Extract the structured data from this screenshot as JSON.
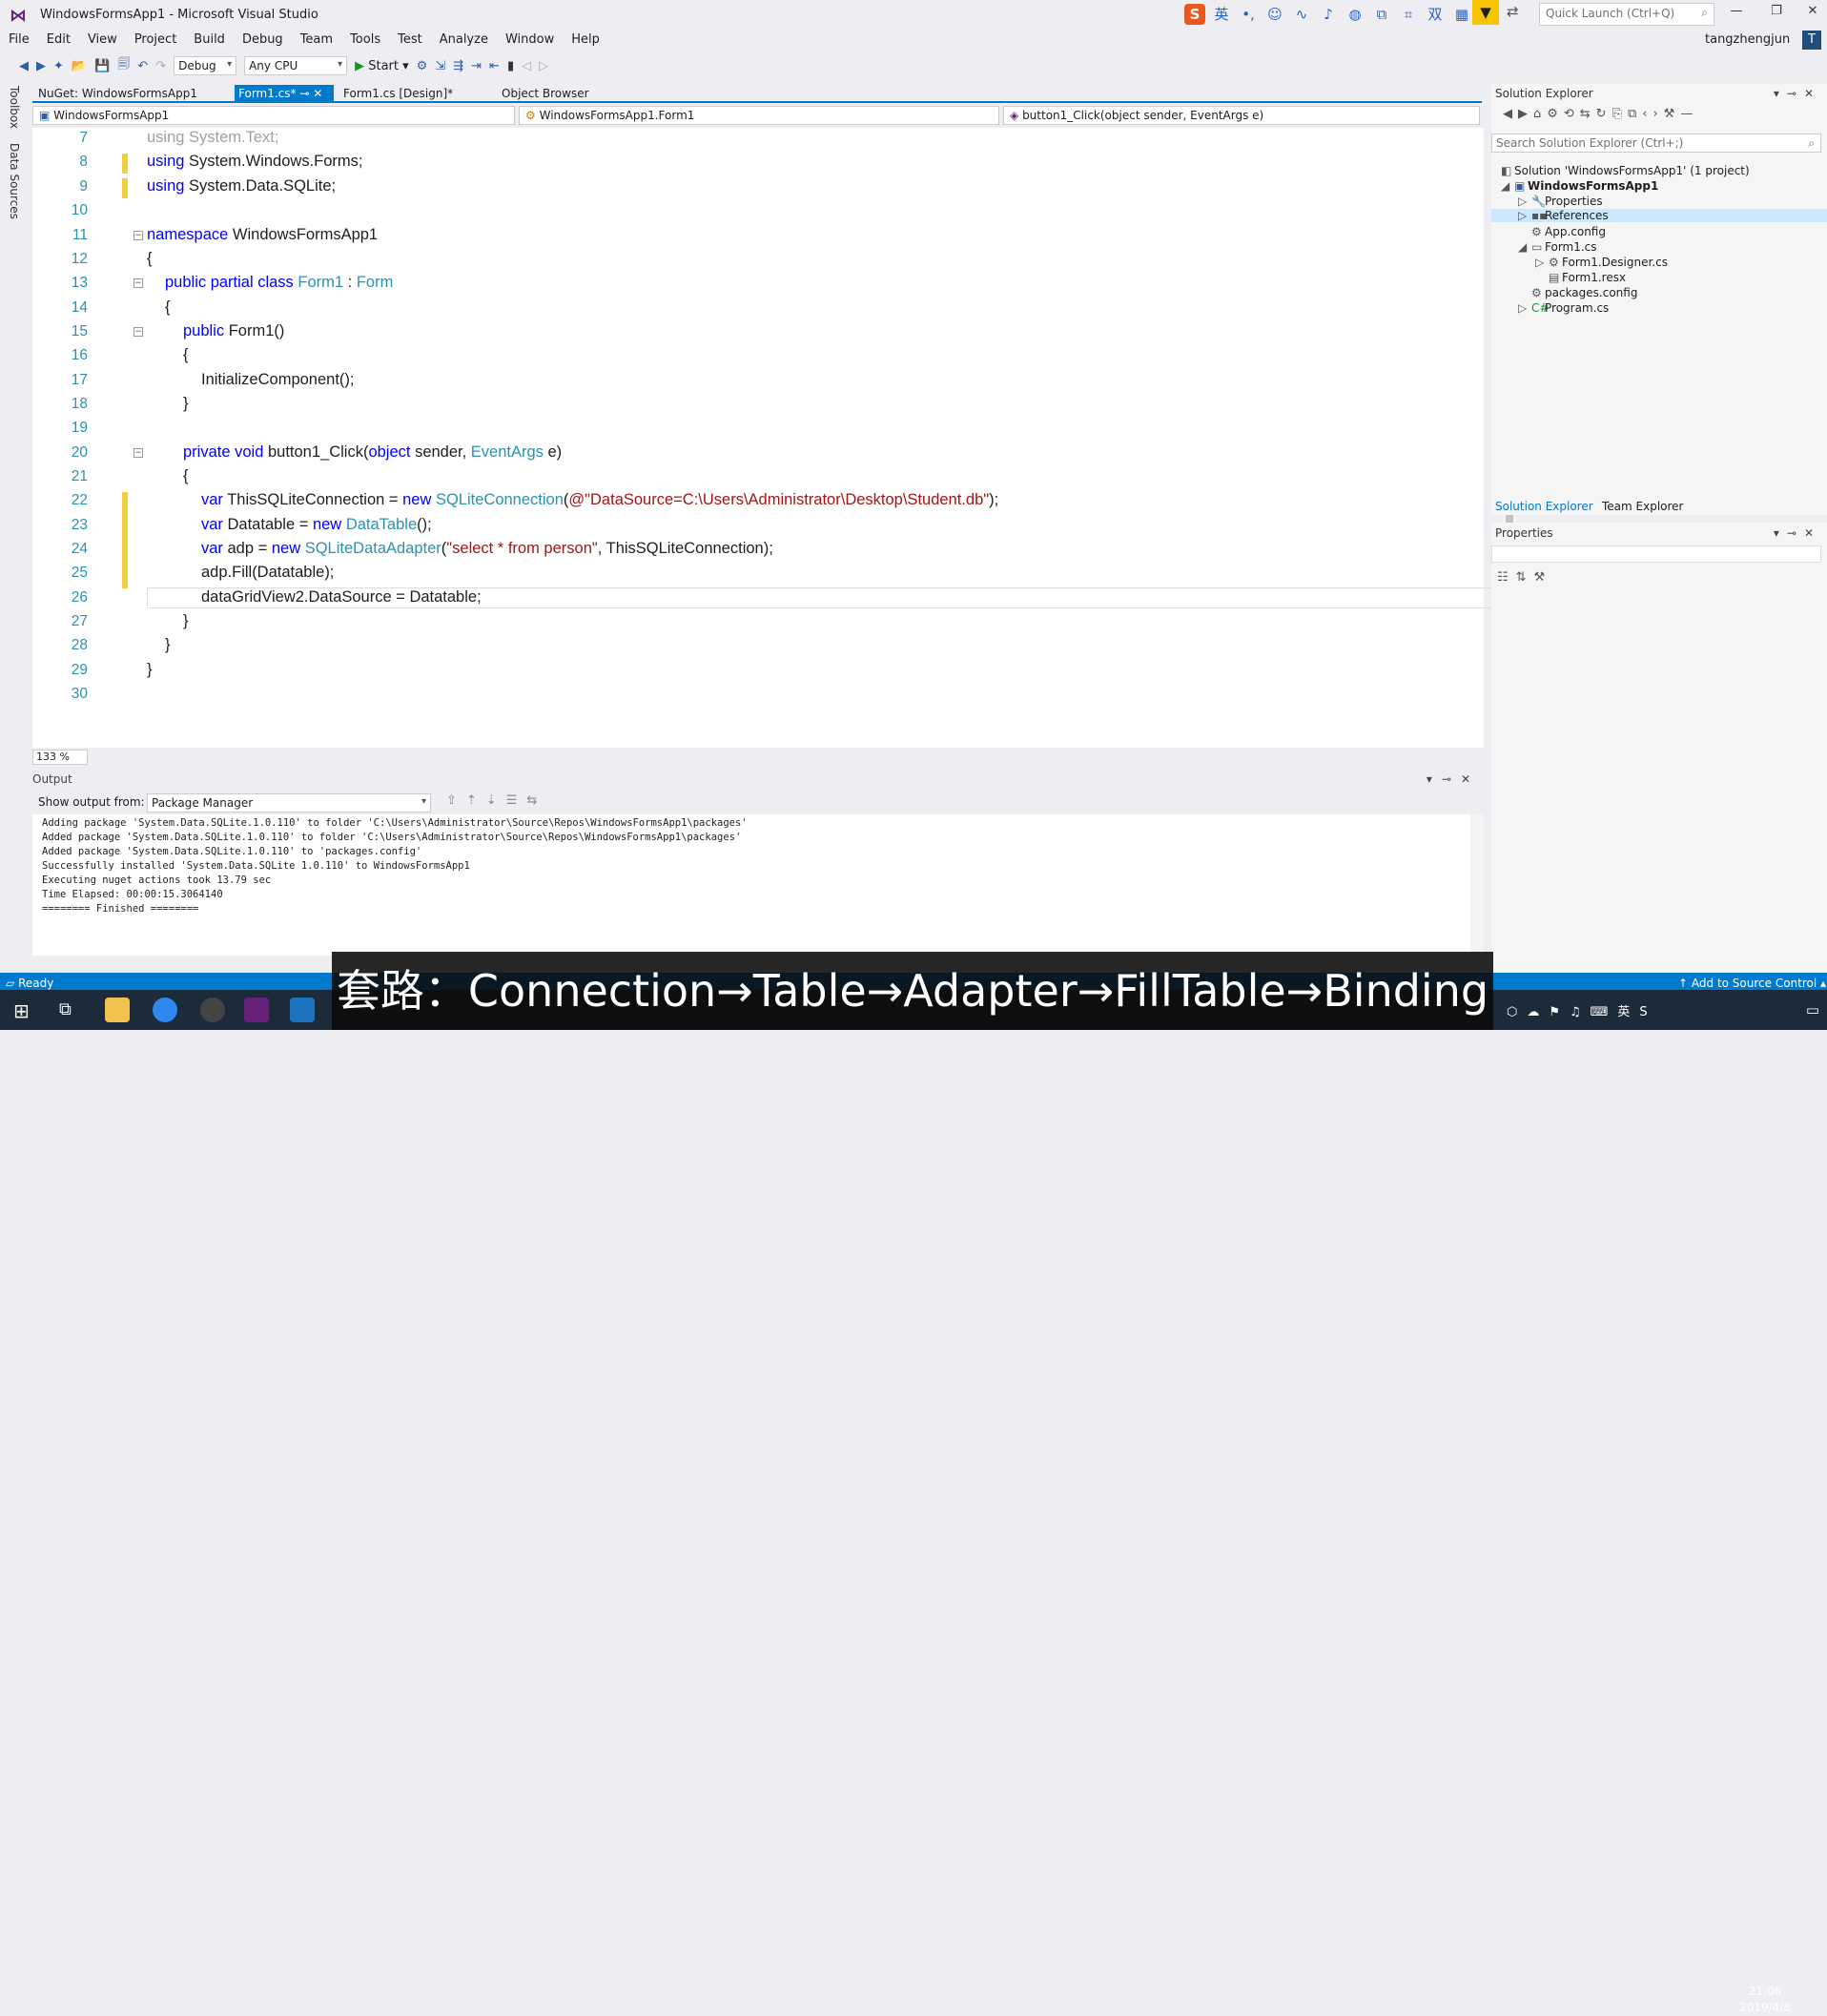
{
  "window": {
    "title": "WindowsFormsApp1 - Microsoft Visual Studio",
    "quick_launch": "Quick Launch (Ctrl+Q)",
    "user": "tangzhengjun",
    "avatar": "T"
  },
  "menu": [
    "File",
    "Edit",
    "View",
    "Project",
    "Build",
    "Debug",
    "Team",
    "Tools",
    "Test",
    "Analyze",
    "Window",
    "Help"
  ],
  "toolbar": {
    "config": "Debug",
    "platform": "Any CPU",
    "start": "Start"
  },
  "side": {
    "toolbox": "Toolbox",
    "datasources": "Data Sources"
  },
  "tabs": [
    {
      "label": "NuGet: WindowsFormsApp1"
    },
    {
      "label": "Form1.cs*"
    },
    {
      "label": "Form1.cs [Design]*"
    },
    {
      "label": "Object Browser"
    }
  ],
  "nav": {
    "project": "WindowsFormsApp1",
    "class": "WindowsFormsApp1.Form1",
    "member": "button1_Click(object sender, EventArgs e)"
  },
  "code": {
    "lines": [
      "7",
      "8",
      "9",
      "10",
      "11",
      "12",
      "13",
      "14",
      "15",
      "16",
      "17",
      "18",
      "19",
      "20",
      "21",
      "22",
      "23",
      "24",
      "25",
      "26",
      "27",
      "28",
      "29",
      "30"
    ],
    "l7": "using System.Text;",
    "l8a": "using",
    "l8b": " System.Windows.Forms;",
    "l9a": "using",
    "l9b": " System.Data.SQLite;",
    "l11a": "namespace",
    "l11b": " WindowsFormsApp1",
    "l12": "{",
    "l13a": "public partial class ",
    "l13b": "Form1",
    "l13c": " : ",
    "l13d": "Form",
    "l14": "{",
    "l15a": "public",
    "l15b": " Form1()",
    "l16": "{",
    "l17": "InitializeComponent();",
    "l18": "}",
    "l20a": "private void",
    "l20b": " button1_Click(",
    "l20c": "object",
    "l20d": " sender, ",
    "l20e": "EventArgs",
    "l20f": " e)",
    "l21": "{",
    "l22a": "var",
    "l22b": " ThisSQLiteConnection = ",
    "l22c": "new",
    "l22d": " SQLiteConnection",
    "l22e": "(",
    "l22f": "@\"DataSource=C:\\Users\\Administrator\\Desktop\\Student.db\"",
    "l22g": ");",
    "l23a": "var",
    "l23b": " Datatable = ",
    "l23c": "new",
    "l23d": " DataTable",
    "l23e": "();",
    "l24a": "var",
    "l24b": " adp = ",
    "l24c": "new",
    "l24d": " SQLiteDataAdapter",
    "l24e": "(",
    "l24f": "\"select * from person\"",
    "l24g": ", ThisSQLiteConnection);",
    "l25": "adp.Fill(Datatable);",
    "l26": "dataGridView2.DataSource = Datatable;",
    "l27": "}",
    "l28": "}",
    "l29": "}"
  },
  "zoom": "133 %",
  "output": {
    "title": "Output",
    "show_from": "Show output from:",
    "source": "Package Manager",
    "text": "Adding package 'System.Data.SQLite.1.0.110' to folder 'C:\\Users\\Administrator\\Source\\Repos\\WindowsFormsApp1\\packages'\nAdded package 'System.Data.SQLite.1.0.110' to folder 'C:\\Users\\Administrator\\Source\\Repos\\WindowsFormsApp1\\packages'\nAdded package 'System.Data.SQLite.1.0.110' to 'packages.config'\nSuccessfully installed 'System.Data.SQLite 1.0.110' to WindowsFormsApp1\nExecuting nuget actions took 13.79 sec\nTime Elapsed: 00:00:15.3064140\n======== Finished ========"
  },
  "solution": {
    "title": "Solution Explorer",
    "search": "Search Solution Explorer (Ctrl+;)",
    "items": [
      "Solution 'WindowsFormsApp1' (1 project)",
      "WindowsFormsApp1",
      "Properties",
      "References",
      "App.config",
      "Form1.cs",
      "Form1.Designer.cs",
      "Form1.resx",
      "packages.config",
      "Program.cs"
    ],
    "tab_sol": "Solution Explorer",
    "tab_team": "Team Explorer"
  },
  "properties": {
    "title": "Properties"
  },
  "status": {
    "ready": "Ready",
    "source_control": "Add to Source Control"
  },
  "caption": "套路：Connection→Table→Adapter→FillTable→Binding",
  "clock": {
    "time": "21:06",
    "date": "2019/4/8"
  }
}
